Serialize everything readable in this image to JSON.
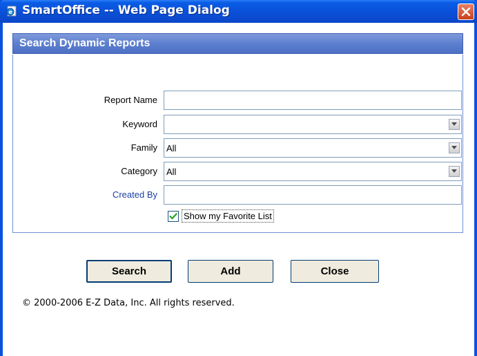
{
  "window": {
    "title": "SmartOffice -- Web Page Dialog"
  },
  "section": {
    "title": "Search Dynamic Reports"
  },
  "form": {
    "report_name_label": "Report Name",
    "report_name_value": "",
    "keyword_label": "Keyword",
    "keyword_value": "",
    "family_label": "Family",
    "family_value": "All",
    "category_label": "Category",
    "category_value": "All",
    "created_by_label": "Created By",
    "created_by_value": "",
    "favorite_label": "Show my Favorite List",
    "favorite_checked": true
  },
  "buttons": {
    "search": "Search",
    "add": "Add",
    "close": "Close"
  },
  "footer": {
    "copyright": "© 2000-2006 E-Z Data, Inc. All rights reserved."
  },
  "colors": {
    "titlebar": "#0a4fd8",
    "section_header": "#5d7fcf",
    "created_by_label": "#1a3fa0",
    "checkmark": "#21a121"
  },
  "icons": {
    "title": "ie-page-icon",
    "close": "close-icon",
    "dropdown": "chevron-down-icon",
    "check": "checkmark-icon"
  }
}
